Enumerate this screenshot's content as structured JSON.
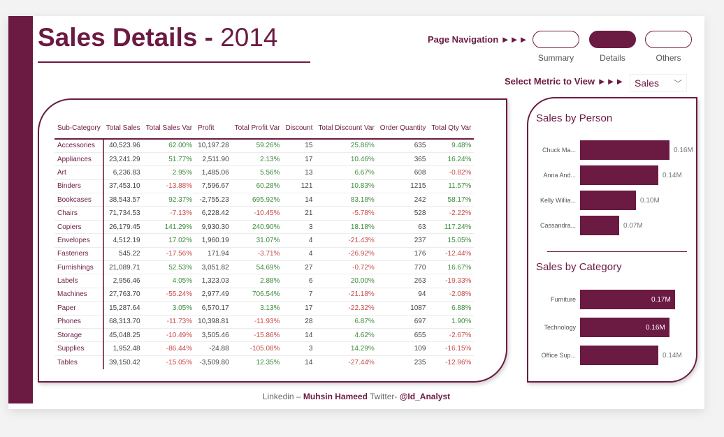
{
  "header": {
    "title_bold": "Sales Details -",
    "title_year": "2014"
  },
  "navigation": {
    "label": "Page Navigation ►►►",
    "buttons": [
      {
        "label": "Summary",
        "active": false
      },
      {
        "label": "Details",
        "active": true
      },
      {
        "label": "Others",
        "active": false
      }
    ]
  },
  "metric": {
    "label": "Select Metric to View ►►►",
    "selected": "Sales",
    "chevron": "﹀"
  },
  "table": {
    "columns": [
      "Sub-Category",
      "Total Sales",
      "Total Sales Var",
      "Profit",
      "Total Profit Var",
      "Discount",
      "Total Discount Var",
      "Order Quantity",
      "Total Qty Var"
    ],
    "rows": [
      [
        "Accessories",
        "40,523.96",
        "62.00%",
        "10,197.28",
        "59.26%",
        "15",
        "25.86%",
        "635",
        "9.48%"
      ],
      [
        "Appliances",
        "23,241.29",
        "51.77%",
        "2,511.90",
        "2.13%",
        "17",
        "10.46%",
        "365",
        "16.24%"
      ],
      [
        "Art",
        "6,236.83",
        "2.95%",
        "1,485.06",
        "5.56%",
        "13",
        "6.67%",
        "608",
        "-0.82%"
      ],
      [
        "Binders",
        "37,453.10",
        "-13.88%",
        "7,596.67",
        "60.28%",
        "121",
        "10.83%",
        "1215",
        "11.57%"
      ],
      [
        "Bookcases",
        "38,543.57",
        "92.37%",
        "-2,755.23",
        "695.92%",
        "14",
        "83.18%",
        "242",
        "58.17%"
      ],
      [
        "Chairs",
        "71,734.53",
        "-7.13%",
        "6,228.42",
        "-10.45%",
        "21",
        "-5.78%",
        "528",
        "-2.22%"
      ],
      [
        "Copiers",
        "26,179.45",
        "141.29%",
        "9,930.30",
        "240.90%",
        "3",
        "18.18%",
        "63",
        "117.24%"
      ],
      [
        "Envelopes",
        "4,512.19",
        "17.02%",
        "1,960.19",
        "31.07%",
        "4",
        "-21.43%",
        "237",
        "15.05%"
      ],
      [
        "Fasteners",
        "545.22",
        "-17.56%",
        "171.94",
        "-3.71%",
        "4",
        "-26.92%",
        "176",
        "-12.44%"
      ],
      [
        "Furnishings",
        "21,089.71",
        "52.53%",
        "3,051.82",
        "54.69%",
        "27",
        "-0.72%",
        "770",
        "16.67%"
      ],
      [
        "Labels",
        "2,956.46",
        "4.05%",
        "1,323.03",
        "2.88%",
        "6",
        "20.00%",
        "263",
        "-19.33%"
      ],
      [
        "Machines",
        "27,763.70",
        "-55.24%",
        "2,977.49",
        "706.54%",
        "7",
        "-21.18%",
        "94",
        "-2.08%"
      ],
      [
        "Paper",
        "15,287.64",
        "3.05%",
        "6,570.17",
        "3.13%",
        "17",
        "-22.32%",
        "1087",
        "6.88%"
      ],
      [
        "Phones",
        "68,313.70",
        "-11.73%",
        "10,398.81",
        "-11.93%",
        "28",
        "6.87%",
        "697",
        "1.90%"
      ],
      [
        "Storage",
        "45,048.25",
        "-10.49%",
        "3,505.46",
        "-15.86%",
        "14",
        "4.62%",
        "655",
        "-2.67%"
      ],
      [
        "Supplies",
        "1,952.48",
        "-86.44%",
        "-24.88",
        "-105.08%",
        "3",
        "14.29%",
        "109",
        "-16.15%"
      ],
      [
        "Tables",
        "39,150.42",
        "-15.05%",
        "-3,509.80",
        "12.35%",
        "14",
        "-27.44%",
        "235",
        "-12.96%"
      ]
    ]
  },
  "colors": {
    "brand": "#6b1a41",
    "positive": "#3d8b3d",
    "negative": "#c84b4b"
  },
  "chart_data": [
    {
      "type": "bar",
      "orientation": "horizontal",
      "title": "Sales by Person",
      "categories": [
        "Chuck Ma...",
        "Anna And...",
        "Kelly Willia...",
        "Cassandra..."
      ],
      "values": [
        0.16,
        0.14,
        0.1,
        0.07
      ],
      "value_labels": [
        "0.16M",
        "0.14M",
        "0.10M",
        "0.07M"
      ],
      "unit": "M",
      "xlim": [
        0,
        0.175
      ],
      "grid": false
    },
    {
      "type": "bar",
      "orientation": "horizontal",
      "title": "Sales by Category",
      "categories": [
        "Furniture",
        "Technology",
        "Office Sup..."
      ],
      "values": [
        0.17,
        0.16,
        0.14
      ],
      "value_labels": [
        "0.17M",
        "0.16M",
        "0.14M"
      ],
      "unit": "M",
      "xlim": [
        0,
        0.175
      ],
      "grid": false
    }
  ],
  "footer": {
    "prefix": "Linkedin – ",
    "name": "Muhsin Hameed",
    "twitter_prefix": " Twitter- ",
    "handle": "@Id_Analyst"
  }
}
